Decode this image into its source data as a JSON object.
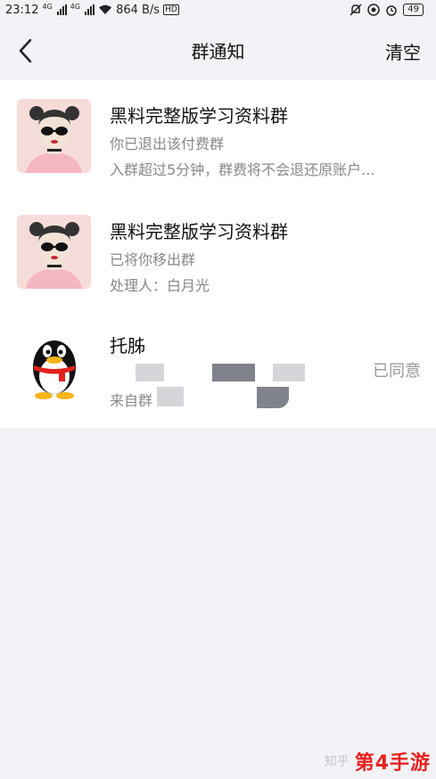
{
  "status_bar": {
    "time": "23:12",
    "net1": "4G",
    "net2": "4G",
    "speed": "864 B/s",
    "hd": "HD",
    "battery": "49"
  },
  "header": {
    "title": "群通知",
    "clear_label": "清空"
  },
  "notifications": [
    {
      "name": "黑料完整版学习资料群",
      "line1": "你已退出该付费群",
      "line2": "入群超过5分钟，群费将不会退还原账户..."
    },
    {
      "name": "黑料完整版学习资料群",
      "line1": "已将你移出群",
      "line2": "处理人：白月光"
    },
    {
      "name": "托胏",
      "line2": "来自群",
      "status": "已同意"
    }
  ],
  "watermark": {
    "zhihu": "知乎",
    "logo": "第4手游"
  },
  "colors": {
    "background": "#f3f3f7",
    "card": "#ffffff",
    "subtext": "#888888"
  }
}
